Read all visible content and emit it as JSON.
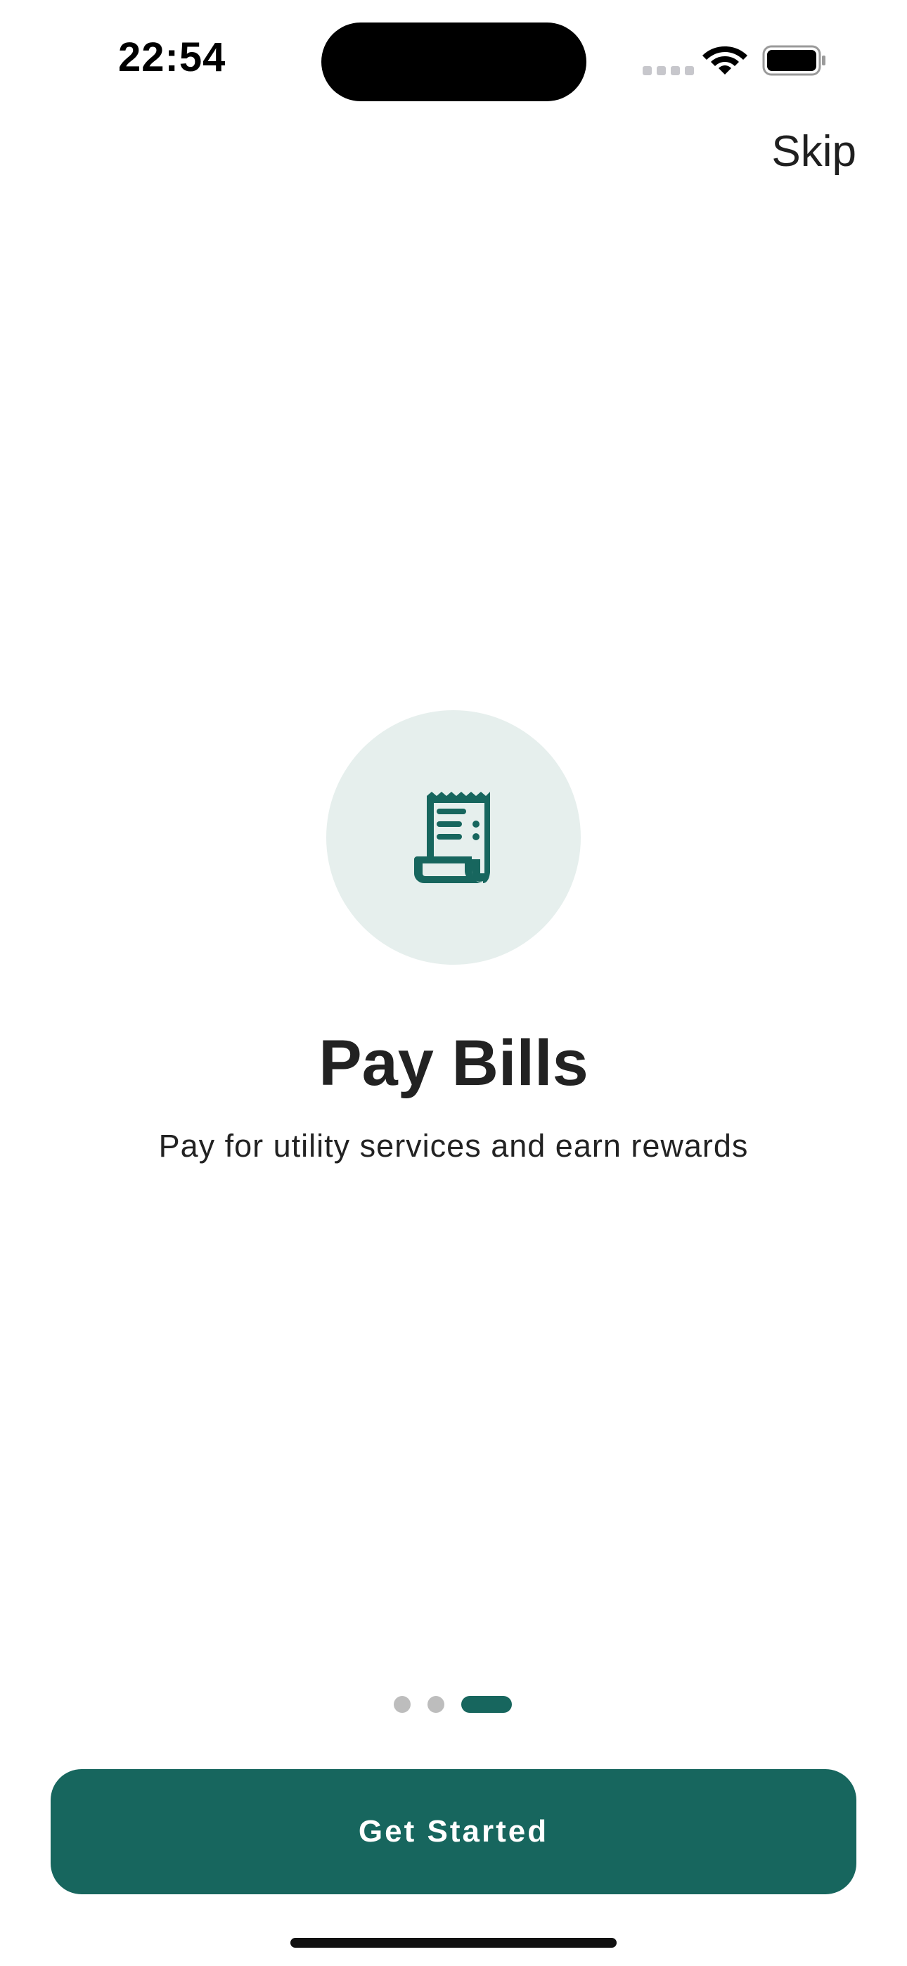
{
  "status_bar": {
    "time": "22:54",
    "wifi_icon": "wifi-icon",
    "battery_icon": "battery-icon",
    "signal_icon": "signal-icon"
  },
  "header": {
    "skip_label": "Skip"
  },
  "onboarding": {
    "icon": "receipt-icon",
    "title": "Pay Bills",
    "subtitle": "Pay for utility services and earn rewards"
  },
  "pager": {
    "total_pages": 3,
    "active_index": 2
  },
  "cta": {
    "label": "Get Started"
  },
  "colors": {
    "accent": "#17665e",
    "icon_bg": "#e6efed",
    "dot_inactive": "#bdbdbd"
  }
}
